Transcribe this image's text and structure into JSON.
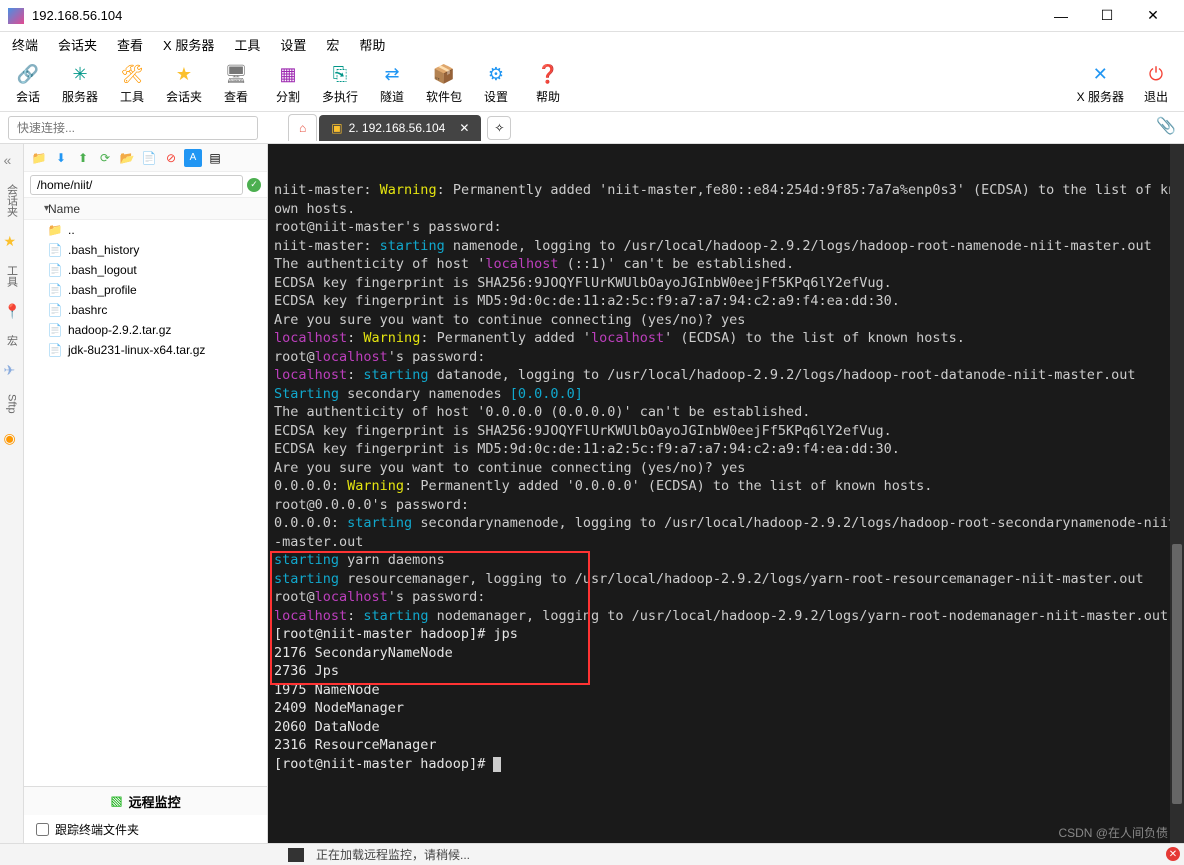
{
  "window": {
    "title": "192.168.56.104"
  },
  "menu": [
    "终端",
    "会话夹",
    "查看",
    "X 服务器",
    "工具",
    "设置",
    "宏",
    "帮助"
  ],
  "toolbar": [
    {
      "icon": "🔗",
      "label": "会话",
      "color": "ic-blue"
    },
    {
      "icon": "✳",
      "label": "服务器",
      "color": "ic-teal"
    },
    {
      "icon": "🛠",
      "label": "工具",
      "color": "ic-orange"
    },
    {
      "icon": "★",
      "label": "会话夹",
      "color": "ic-yellow"
    },
    {
      "icon": "🖥",
      "label": "查看",
      "color": "ic-gray"
    },
    {
      "icon": "▦",
      "label": "分割",
      "color": "ic-purple"
    },
    {
      "icon": "⎘",
      "label": "多执行",
      "color": "ic-teal"
    },
    {
      "icon": "⇄",
      "label": "隧道",
      "color": "ic-blue"
    },
    {
      "icon": "📦",
      "label": "软件包",
      "color": "ic-blue"
    },
    {
      "icon": "⚙",
      "label": "设置",
      "color": "ic-blue"
    },
    {
      "icon": "❓",
      "label": "帮助",
      "color": "ic-blue"
    }
  ],
  "toolbar_right": [
    {
      "icon": "✕",
      "label": "X 服务器",
      "color": "ic-blue"
    },
    {
      "icon": "⏻",
      "label": "退出",
      "color": "ic-red"
    }
  ],
  "quick_connect_placeholder": "快速连接...",
  "tabs": {
    "active_label": "2. 192.168.56.104"
  },
  "filepanel": {
    "path": "/home/niit/",
    "name_header": "Name",
    "items": [
      {
        "name": "..",
        "type": "up"
      },
      {
        "name": ".bash_history",
        "type": "file"
      },
      {
        "name": ".bash_logout",
        "type": "file"
      },
      {
        "name": ".bash_profile",
        "type": "file"
      },
      {
        "name": ".bashrc",
        "type": "file"
      },
      {
        "name": "hadoop-2.9.2.tar.gz",
        "type": "file"
      },
      {
        "name": "jdk-8u231-linux-x64.tar.gz",
        "type": "file"
      }
    ],
    "monitor": "远程监控",
    "follow": "跟踪终端文件夹"
  },
  "sidetabs": [
    "会话夹",
    "工具",
    "宏",
    "Sftp"
  ],
  "terminal_lines": [
    [
      {
        "t": "niit-master: ",
        "c": ""
      },
      {
        "t": "Warning",
        "c": "tc-yellow"
      },
      {
        "t": ": Permanently added 'niit-master,fe80::e84:254d:9f85:7a7a%enp0s3' (ECDSA) to the list of known hosts.",
        "c": ""
      }
    ],
    [
      {
        "t": "root@niit-master's password:",
        "c": ""
      }
    ],
    [
      {
        "t": "niit-master: ",
        "c": ""
      },
      {
        "t": "starting",
        "c": "tc-cyan"
      },
      {
        "t": " namenode, logging to /usr/local/hadoop-2.9.2/logs/hadoop-root-namenode-niit-master.out",
        "c": ""
      }
    ],
    [
      {
        "t": "The authenticity of host '",
        "c": ""
      },
      {
        "t": "localhost",
        "c": "tc-magenta"
      },
      {
        "t": " (::1)' can't be established.",
        "c": ""
      }
    ],
    [
      {
        "t": "ECDSA key fingerprint is SHA256:9JOQYFlUrKWUlbOayoJGInbW0eejFf5KPq6lY2efVug.",
        "c": ""
      }
    ],
    [
      {
        "t": "ECDSA key fingerprint is MD5:9d:0c:de:11:a2:5c:f9:a7:a7:94:c2:a9:f4:ea:dd:30.",
        "c": ""
      }
    ],
    [
      {
        "t": "Are you sure you want to continue connecting (yes/no)? yes",
        "c": ""
      }
    ],
    [
      {
        "t": "localhost",
        "c": "tc-magenta"
      },
      {
        "t": ": ",
        "c": ""
      },
      {
        "t": "Warning",
        "c": "tc-yellow"
      },
      {
        "t": ": Permanently added '",
        "c": ""
      },
      {
        "t": "localhost",
        "c": "tc-magenta"
      },
      {
        "t": "' (ECDSA) to the list of known hosts.",
        "c": ""
      }
    ],
    [
      {
        "t": "root@",
        "c": ""
      },
      {
        "t": "localhost",
        "c": "tc-magenta"
      },
      {
        "t": "'s password:",
        "c": ""
      }
    ],
    [
      {
        "t": "localhost",
        "c": "tc-magenta"
      },
      {
        "t": ": ",
        "c": ""
      },
      {
        "t": "starting",
        "c": "tc-cyan"
      },
      {
        "t": " datanode, logging to /usr/local/hadoop-2.9.2/logs/hadoop-root-datanode-niit-master.out",
        "c": ""
      }
    ],
    [
      {
        "t": "Starting",
        "c": "tc-cyan"
      },
      {
        "t": " secondary namenodes ",
        "c": ""
      },
      {
        "t": "[0.0.0.0]",
        "c": "tc-cyan"
      }
    ],
    [
      {
        "t": "The authenticity of host '0.0.0.0 (0.0.0.0)' can't be established.",
        "c": ""
      }
    ],
    [
      {
        "t": "ECDSA key fingerprint is SHA256:9JOQYFlUrKWUlbOayoJGInbW0eejFf5KPq6lY2efVug.",
        "c": ""
      }
    ],
    [
      {
        "t": "ECDSA key fingerprint is MD5:9d:0c:de:11:a2:5c:f9:a7:a7:94:c2:a9:f4:ea:dd:30.",
        "c": ""
      }
    ],
    [
      {
        "t": "Are you sure you want to continue connecting (yes/no)? yes",
        "c": ""
      }
    ],
    [
      {
        "t": "0.0.0.0: ",
        "c": ""
      },
      {
        "t": "Warning",
        "c": "tc-yellow"
      },
      {
        "t": ": Permanently added '0.0.0.0' (ECDSA) to the list of known hosts.",
        "c": ""
      }
    ],
    [
      {
        "t": "root@0.0.0.0's password:",
        "c": ""
      }
    ],
    [
      {
        "t": "0.0.0.0: ",
        "c": ""
      },
      {
        "t": "starting",
        "c": "tc-cyan"
      },
      {
        "t": " secondarynamenode, logging to /usr/local/hadoop-2.9.2/logs/hadoop-root-secondarynamenode-niit-master.out",
        "c": ""
      }
    ],
    [
      {
        "t": "starting",
        "c": "tc-cyan"
      },
      {
        "t": " yarn daemons",
        "c": ""
      }
    ],
    [
      {
        "t": "starting",
        "c": "tc-cyan"
      },
      {
        "t": " resourcemanager, logging to /usr/local/hadoop-2.9.2/logs/yarn-root-resourcemanager-niit-master.out",
        "c": ""
      }
    ],
    [
      {
        "t": "root@",
        "c": ""
      },
      {
        "t": "localhost",
        "c": "tc-magenta"
      },
      {
        "t": "'s password:",
        "c": ""
      }
    ],
    [
      {
        "t": "localhost",
        "c": "tc-magenta"
      },
      {
        "t": ": ",
        "c": ""
      },
      {
        "t": "starting",
        "c": "tc-cyan"
      },
      {
        "t": " nodemanager, logging to /usr/local/hadoop-2.9.2/logs/yarn-root-nodemanager-niit-master.out",
        "c": ""
      }
    ],
    [
      {
        "t": "[root@niit-master hadoop]# jps",
        "c": "tc-white"
      }
    ],
    [
      {
        "t": "2176 SecondaryNameNode",
        "c": "tc-white"
      }
    ],
    [
      {
        "t": "2736 Jps",
        "c": "tc-white"
      }
    ],
    [
      {
        "t": "1975 NameNode",
        "c": "tc-white"
      }
    ],
    [
      {
        "t": "2409 NodeManager",
        "c": "tc-white"
      }
    ],
    [
      {
        "t": "2060 DataNode",
        "c": "tc-white"
      }
    ],
    [
      {
        "t": "2316 ResourceManager",
        "c": "tc-white"
      }
    ],
    [
      {
        "t": "[root@niit-master hadoop]# ",
        "c": "tc-white"
      }
    ]
  ],
  "status": {
    "text": "正在加载远程监控，请稍候..."
  },
  "watermark": "CSDN @在人间负债"
}
